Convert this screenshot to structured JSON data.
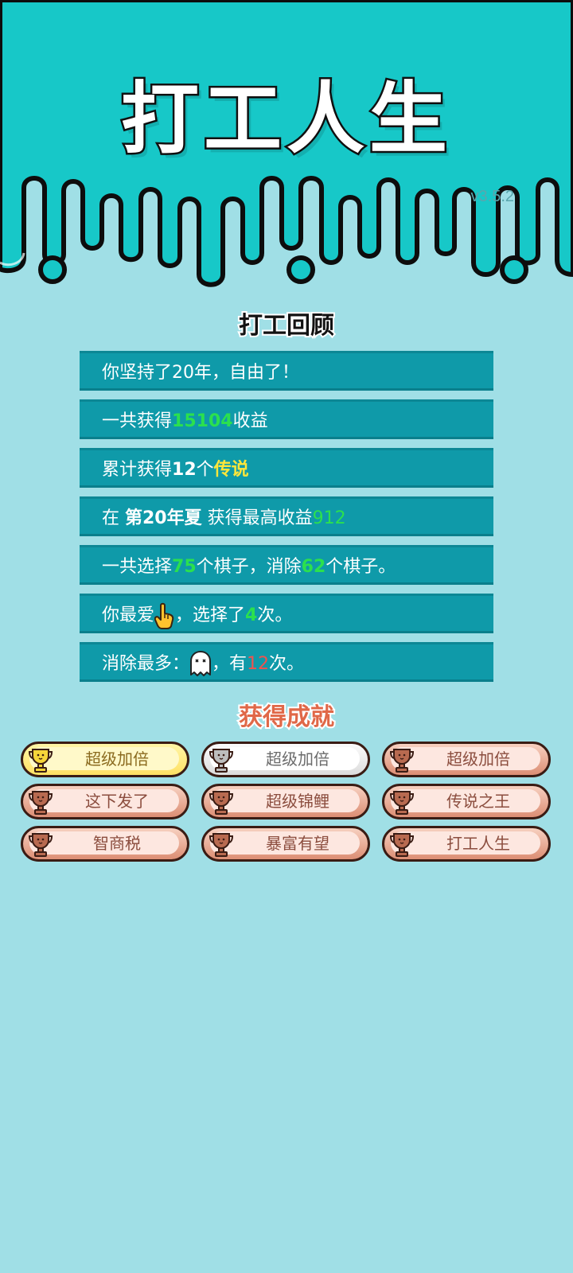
{
  "app": {
    "title": "打工人生",
    "version": "v3.5.2"
  },
  "review": {
    "title": "打工回顾",
    "rows": [
      {
        "text": "你坚持了20年，自由了！"
      },
      {
        "before": "一共获得",
        "value": "15104",
        "after": "收益"
      },
      {
        "before": "累计获得",
        "count": "12",
        "mid": "个",
        "label": "传说"
      },
      {
        "before": "在 ",
        "season": "第20年夏",
        "mid": " 获得最高收益",
        "value": "912"
      },
      {
        "before": "一共选择",
        "value1": "75",
        "mid": "个棋子，消除",
        "value2": "62",
        "after": "个棋子。"
      },
      {
        "before": "你最爱",
        "icon": "pointing-hand-icon",
        "mid": "，选择了",
        "count": "4",
        "after": "次。"
      },
      {
        "before": "消除最多：",
        "icon": "ghost-icon",
        "mid": "，有",
        "count": "12",
        "after": "次。"
      }
    ]
  },
  "achievements": {
    "title": "获得成就",
    "items": [
      {
        "label": "超级加倍",
        "tier": "gold"
      },
      {
        "label": "超级加倍",
        "tier": "silver"
      },
      {
        "label": "超级加倍",
        "tier": "bronze"
      },
      {
        "label": "这下发了",
        "tier": "bronze"
      },
      {
        "label": "超级锦鲤",
        "tier": "bronze"
      },
      {
        "label": "传说之王",
        "tier": "bronze"
      },
      {
        "label": "智商税",
        "tier": "bronze"
      },
      {
        "label": "暴富有望",
        "tier": "bronze"
      },
      {
        "label": "打工人生",
        "tier": "bronze"
      }
    ]
  },
  "colors": {
    "header": "#17c8c8",
    "background": "#a0dfe6",
    "row": "#0f9aa9",
    "green": "#2be04e",
    "yellow": "#ffe63a",
    "red": "#f0524e",
    "gold": "#f6d53a",
    "silver": "#bdbdbd",
    "bronze": "#b86a50"
  }
}
